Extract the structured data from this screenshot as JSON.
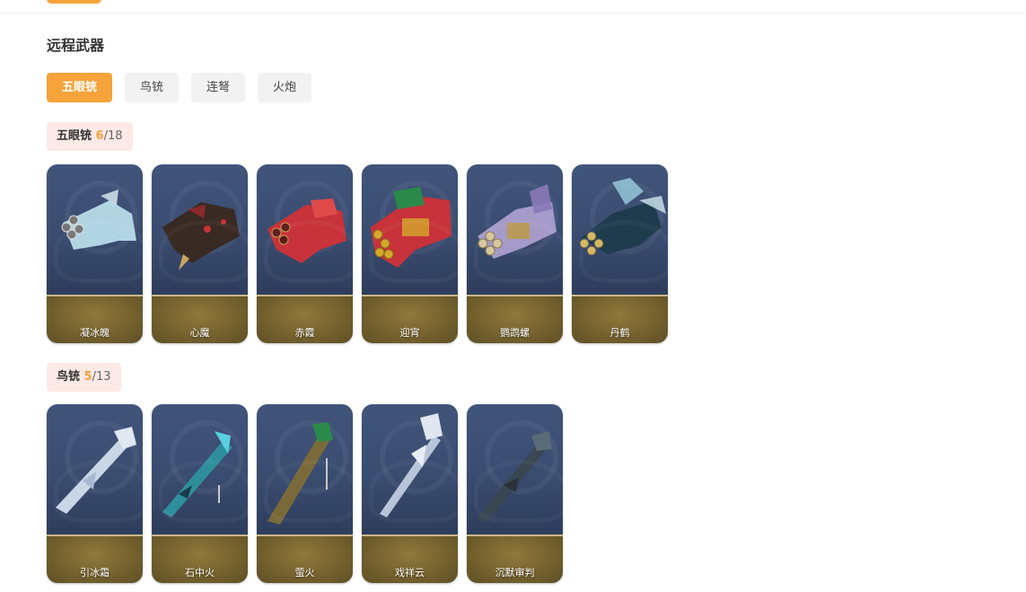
{
  "page": {
    "title": "远程武器"
  },
  "tabs": [
    {
      "label": "五眼铳",
      "active": true
    },
    {
      "label": "鸟铳",
      "active": false
    },
    {
      "label": "连弩",
      "active": false
    },
    {
      "label": "火炮",
      "active": false
    }
  ],
  "sections": [
    {
      "name": "五眼铳",
      "owned": "6",
      "total": "/18",
      "cards": [
        {
          "name": "凝冰魄",
          "icon": "ice-five-barrel-gun-icon",
          "color": "#bfe3ee"
        },
        {
          "name": "心魔",
          "icon": "demon-five-barrel-gun-icon",
          "color": "#3a2a24"
        },
        {
          "name": "赤霞",
          "icon": "red-five-barrel-gun-icon",
          "color": "#c8323a"
        },
        {
          "name": "迎宵",
          "icon": "gold-red-five-barrel-gun-icon",
          "color": "#c89a2a"
        },
        {
          "name": "鹦鹉螺",
          "icon": "nautilus-five-barrel-gun-icon",
          "color": "#a69ac8"
        },
        {
          "name": "丹鹤",
          "icon": "crane-five-barrel-gun-icon",
          "color": "#1f3c4d"
        }
      ]
    },
    {
      "name": "鸟铳",
      "owned": "5",
      "total": "/13",
      "cards": [
        {
          "name": "引冰霜",
          "icon": "frost-musket-icon",
          "color": "#c9d6e6"
        },
        {
          "name": "石中火",
          "icon": "fire-stone-musket-icon",
          "color": "#2f8e9c"
        },
        {
          "name": "萤火",
          "icon": "firefly-musket-icon",
          "color": "#7a6a3a"
        },
        {
          "name": "戏祥云",
          "icon": "cloud-musket-icon",
          "color": "#b8c4d8"
        },
        {
          "name": "沉默审判",
          "icon": "silent-judgment-musket-icon",
          "color": "#3a4652"
        }
      ]
    }
  ]
}
